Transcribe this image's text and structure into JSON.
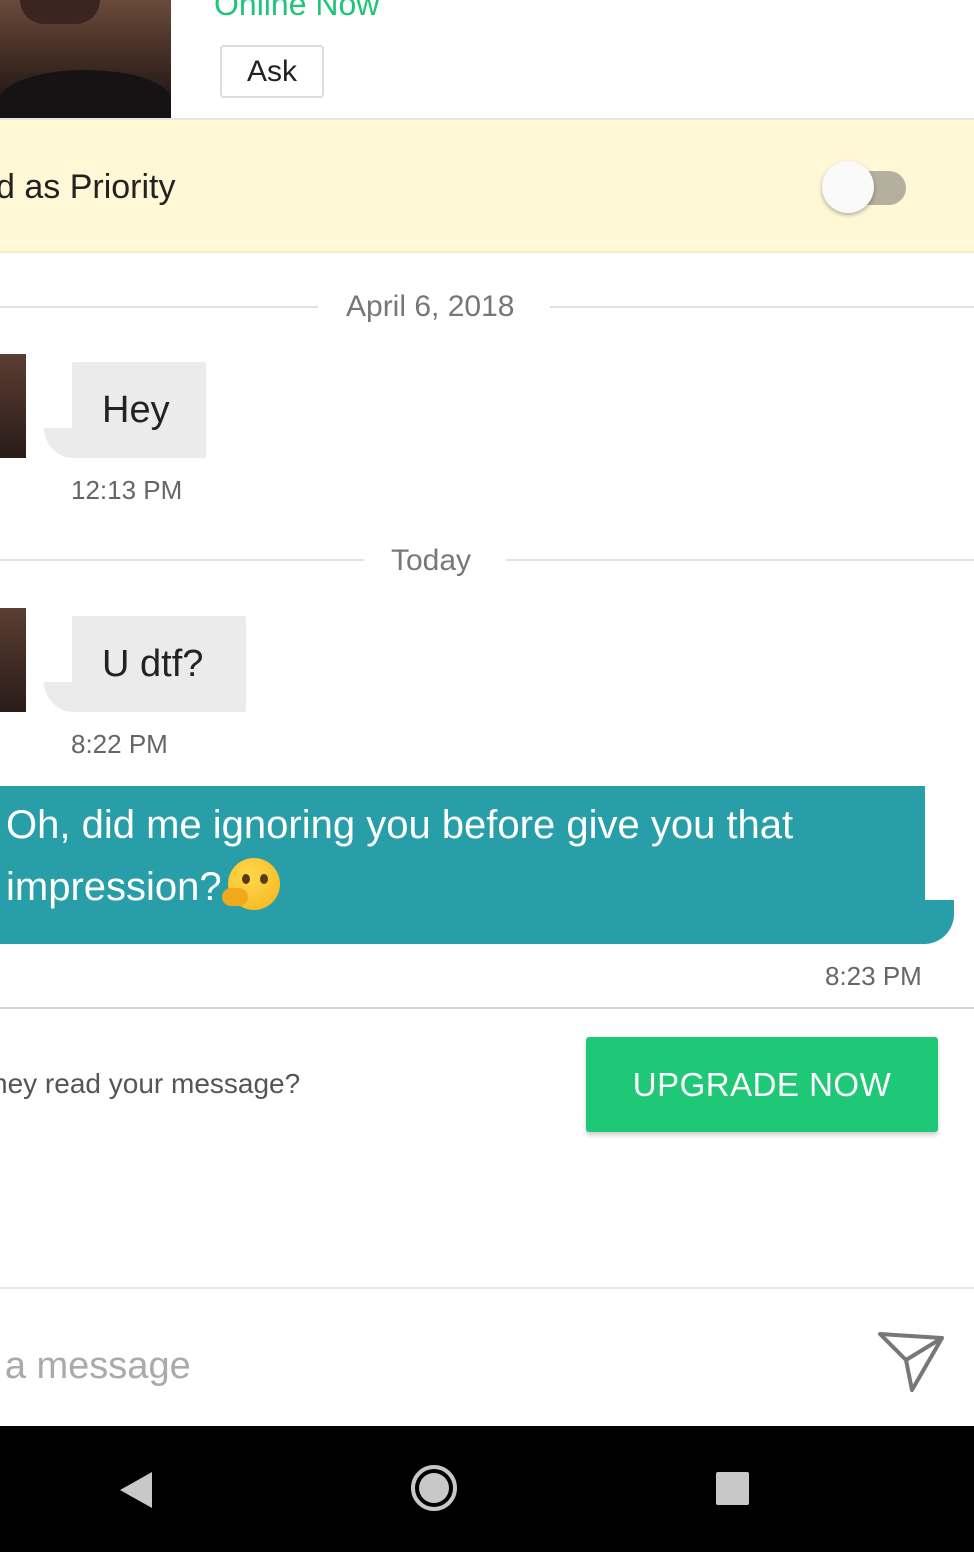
{
  "header": {
    "status": "Online Now",
    "ask_label": "Ask"
  },
  "priority": {
    "label": "d as Priority",
    "toggle_on": false
  },
  "conversation": {
    "separators": [
      "April 6, 2018",
      "Today"
    ],
    "messages": [
      {
        "direction": "incoming",
        "text": "Hey",
        "time": "12:13 PM"
      },
      {
        "direction": "incoming",
        "text": "U dtf?",
        "time": "8:22 PM"
      },
      {
        "direction": "outgoing",
        "text_line1": "Oh, did me ignoring you before give you that",
        "text_line2": "impression?",
        "emoji": "thinking-face",
        "time": "8:23 PM"
      }
    ]
  },
  "upsell": {
    "text": "ney read your message?",
    "button_label": "UPGRADE NOW"
  },
  "composer": {
    "placeholder": "pe a message"
  },
  "colors": {
    "online": "#1ec677",
    "outgoing_bubble": "#289fa8",
    "incoming_bubble": "#ebebeb",
    "upgrade_button": "#1fc877",
    "priority_banner": "#fff8d6"
  }
}
